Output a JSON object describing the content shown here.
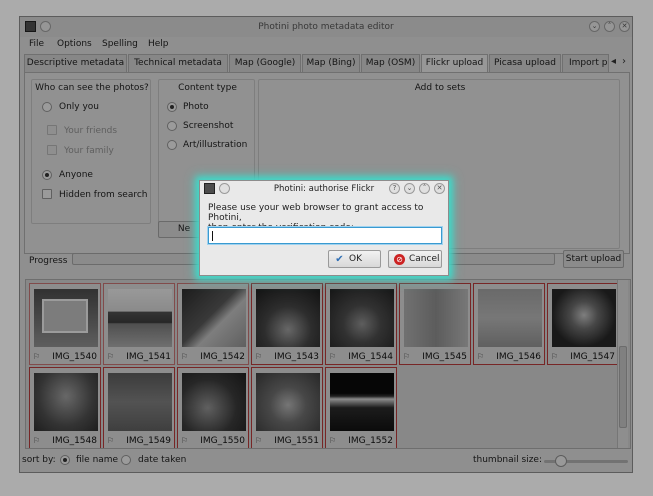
{
  "window": {
    "title": "Photini photo metadata editor",
    "buttons": [
      "⌄",
      "˄",
      "✕"
    ]
  },
  "menu": [
    "File",
    "Options",
    "Spelling",
    "Help"
  ],
  "tabs": [
    {
      "label": "Descriptive metadata",
      "active": false
    },
    {
      "label": "Technical metadata",
      "active": false
    },
    {
      "label": "Map (Google)",
      "active": false
    },
    {
      "label": "Map (Bing)",
      "active": false
    },
    {
      "label": "Map (OSM)",
      "active": false
    },
    {
      "label": "Flickr upload",
      "active": true
    },
    {
      "label": "Picasa upload",
      "active": false
    },
    {
      "label": "Import ph",
      "active": false
    }
  ],
  "tab_arrows": {
    "left": "◂",
    "right": "›"
  },
  "privacy": {
    "title": "Who can see the photos?",
    "only_you": "Only you",
    "your_friends": "Your friends",
    "your_family": "Your family",
    "anyone": "Anyone",
    "hidden": "Hidden from search"
  },
  "content_type": {
    "title": "Content type",
    "photo": "Photo",
    "screenshot": "Screenshot",
    "art": "Art/illustration",
    "new_set_button": "Ne"
  },
  "sets": {
    "title": "Add to sets"
  },
  "progress": {
    "label": "Progress",
    "value": 0
  },
  "start_upload": "Start upload",
  "thumbnails": [
    {
      "name": "IMG_1540",
      "selected": false
    },
    {
      "name": "IMG_1541",
      "selected": false
    },
    {
      "name": "IMG_1542",
      "selected": false
    },
    {
      "name": "IMG_1543",
      "selected": true
    },
    {
      "name": "IMG_1544",
      "selected": true
    },
    {
      "name": "IMG_1545",
      "selected": true
    },
    {
      "name": "IMG_1546",
      "selected": true
    },
    {
      "name": "IMG_1547",
      "selected": true
    },
    {
      "name": "IMG_1548",
      "selected": true
    },
    {
      "name": "IMG_1549",
      "selected": true
    },
    {
      "name": "IMG_1550",
      "selected": true
    },
    {
      "name": "IMG_1551",
      "selected": true
    },
    {
      "name": "IMG_1552",
      "selected": true
    }
  ],
  "bottom": {
    "sort_by": "sort by:",
    "file_name": "file name",
    "date_taken": "date taken",
    "thumbnail_size": "thumbnail size:"
  },
  "dialog": {
    "title": "Photini: authorise Flickr",
    "title_buttons": [
      "?",
      "⌄",
      "˄",
      "✕"
    ],
    "message_line1": "Please use your web browser to grant access to Photini,",
    "message_line2": "then enter the verification code:",
    "input_value": "",
    "ok": "OK",
    "cancel": "Cancel"
  },
  "colors": {
    "dialog_glow": "#3fd9c9",
    "selection_border": "#b23a3a",
    "ok_icon": "#2f6fb5",
    "cancel_icon": "#cc2222"
  }
}
